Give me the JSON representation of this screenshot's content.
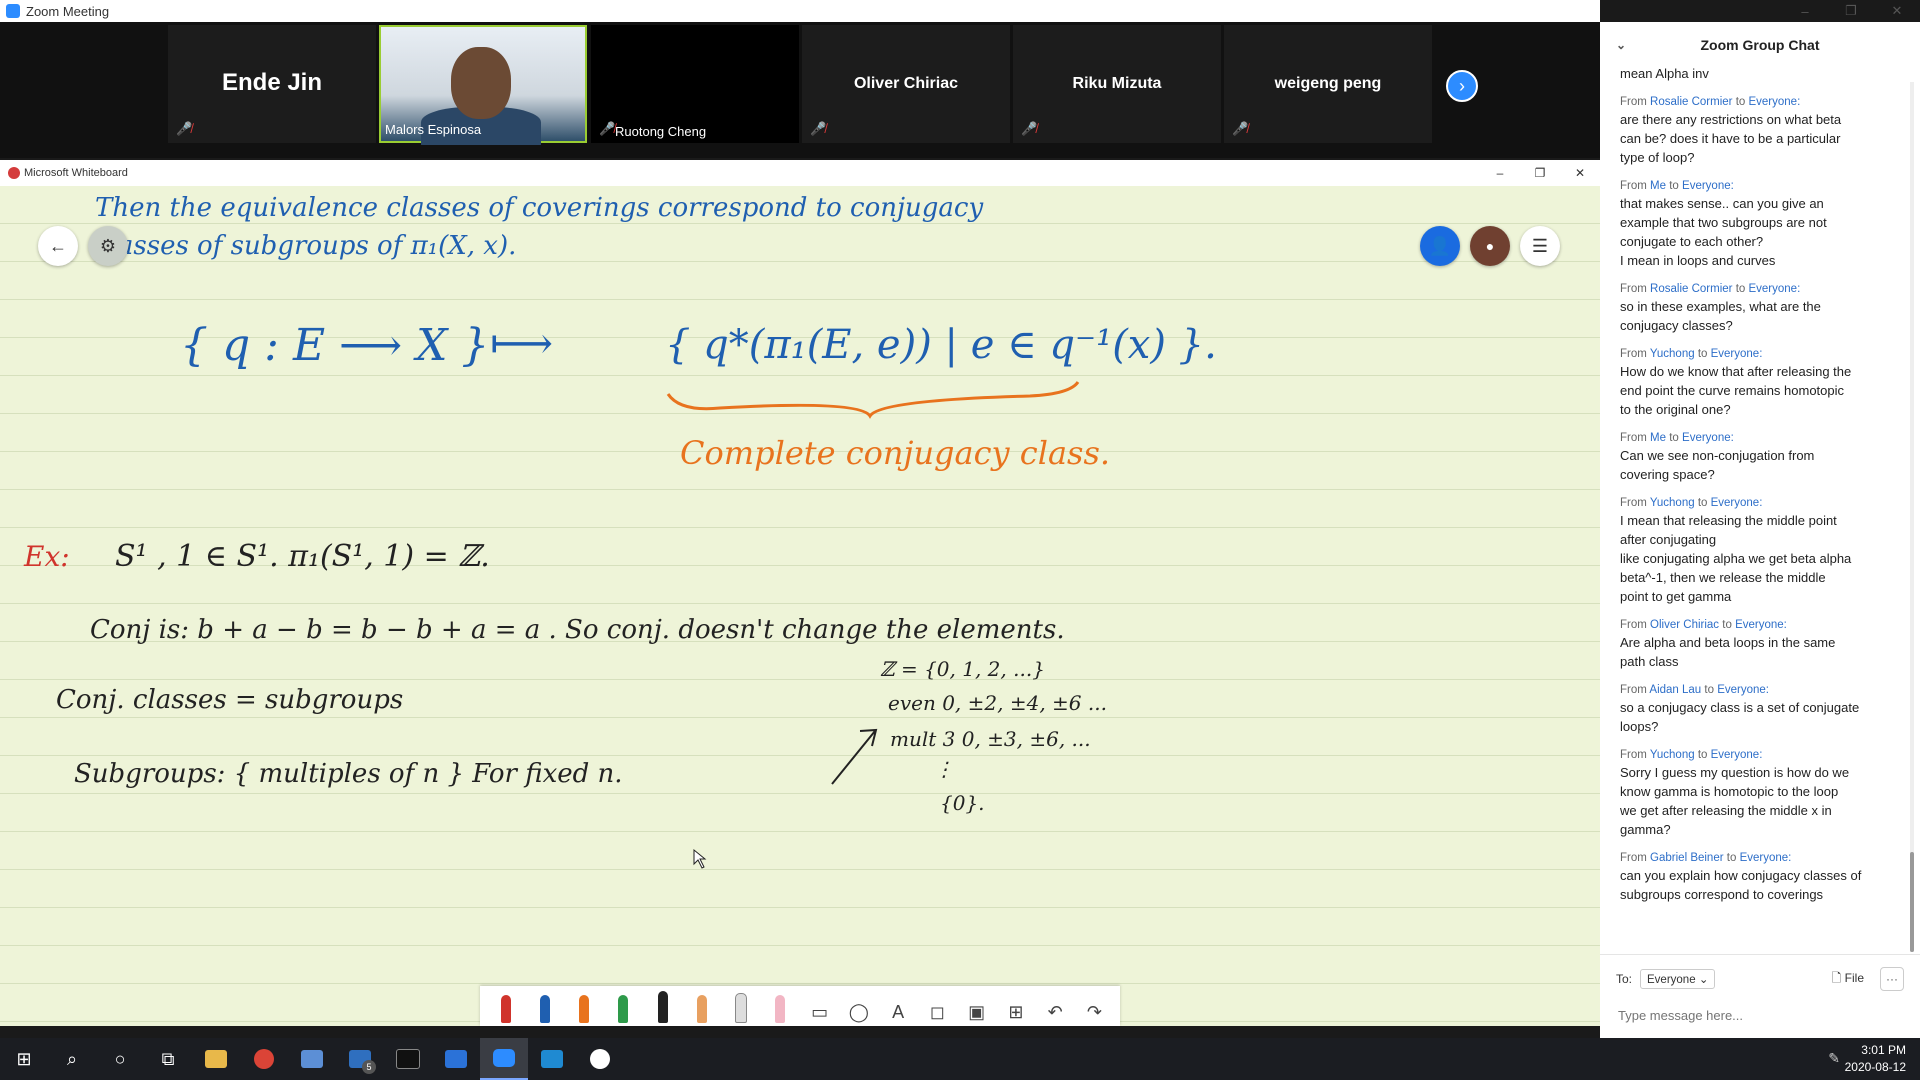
{
  "zoom": {
    "window_title": "Zoom Meeting",
    "participants": [
      {
        "name": "Ende Jin",
        "style": "big"
      },
      {
        "name": "Malors Espinosa",
        "style": "video"
      },
      {
        "name": "Ruotong Cheng",
        "style": "label"
      },
      {
        "name": "Oliver Chiriac",
        "style": "mid"
      },
      {
        "name": "Riku Mizuta",
        "style": "mid"
      },
      {
        "name": "weigeng peng",
        "style": "mid"
      }
    ],
    "next_page_icon": "chevron-right-icon"
  },
  "whiteboard": {
    "window_title": "Microsoft Whiteboard",
    "notes": {
      "line1": "Then   the   equivalence   classes   of   coverings   correspond   to   conjugacy",
      "line2": "classes   of   subgroups   of   π₁(X, x).",
      "set_left": "{ q : E ⟶ X }",
      "maps_to": "⟼",
      "set_right": "{ q*(π₁(E, e))  |  e ∈ q⁻¹(x) }.",
      "complete": "Complete   conjugacy   class.",
      "ex_label": "Ex:",
      "ex_line": "S¹ ,  1 ∈ S¹.          π₁(S¹, 1) =  ℤ.",
      "conj_line": "Conj is:  b + a − b  =  b − b + a = a .   So    conj.   doesn't   change   the   elements.",
      "z_line": "ℤ = {0, 1, 2, ...}",
      "even_line": "even 0, ±2, ±4, ±6 ...",
      "mult3_line": "mult 3     0, ±3, ±6, ...",
      "dots": "⋮",
      "zero_line": "{0}.",
      "classes_line": "Conj. classes   =   subgroups",
      "subgroups_line": "Subgroups:   { multiples  of  n }       For  fixed  n."
    }
  },
  "chat": {
    "title": "Zoom Group Chat",
    "messages": [
      {
        "from": "",
        "to": "",
        "lines": [
          "mean Alpha inv"
        ]
      },
      {
        "from": "Rosalie Cormier",
        "to": "Everyone:",
        "lines": [
          "are there any restrictions on what beta",
          "can be? does it have to be a particular",
          "type of loop?"
        ]
      },
      {
        "from": "Me",
        "to": "Everyone:",
        "lines": [
          "that makes sense.. can you give an",
          "example that two subgroups are not",
          "conjugate to each other?",
          "I mean in loops and curves"
        ]
      },
      {
        "from": "Rosalie Cormier",
        "to": "Everyone:",
        "lines": [
          "so in these examples, what are the",
          "conjugacy classes?"
        ]
      },
      {
        "from": "Yuchong",
        "to": "Everyone:",
        "lines": [
          "How do we know that after releasing the",
          "end point the curve remains homotopic",
          "to the original one?"
        ]
      },
      {
        "from": "Me",
        "to": "Everyone:",
        "lines": [
          "Can we see non-conjugation from",
          "covering space?"
        ]
      },
      {
        "from": "Yuchong",
        "to": "Everyone:",
        "lines": [
          "I mean that releasing the middle point",
          "after conjugating",
          "like conjugating alpha we get beta alpha",
          "beta^-1, then we release the middle",
          "point to get gamma"
        ]
      },
      {
        "from": "Oliver Chiriac",
        "to": "Everyone:",
        "lines": [
          "Are alpha and beta loops in the same",
          "path class"
        ]
      },
      {
        "from": "Aidan Lau",
        "to": "Everyone:",
        "lines": [
          "so a conjugacy class is a set of conjugate",
          "loops?"
        ]
      },
      {
        "from": "Yuchong",
        "to": "Everyone:",
        "lines": [
          "Sorry I guess my  question is how do we",
          "know gamma is homotopic to the loop",
          "we get after releasing the middle x in",
          "gamma?"
        ]
      },
      {
        "from": "Gabriel Beiner",
        "to": "Everyone:",
        "lines": [
          "can you explain how conjugacy classes of",
          "subgroups correspond to coverings"
        ]
      }
    ],
    "from_word": "From",
    "to_word": "to",
    "to_label": "To:",
    "recipient": "Everyone",
    "file_label": "File",
    "placeholder": "Type message here..."
  },
  "taskbar": {
    "time": "3:01 PM",
    "date": "2020-08-12",
    "mail_badge": "5"
  },
  "colors": {
    "zoom_blue": "#2d8cff",
    "ink_blue": "#1f5fb0",
    "ink_orange": "#e8731e",
    "ink_red": "#d0342c",
    "ink_black": "#222222",
    "board_bg": "#eef4d8"
  }
}
